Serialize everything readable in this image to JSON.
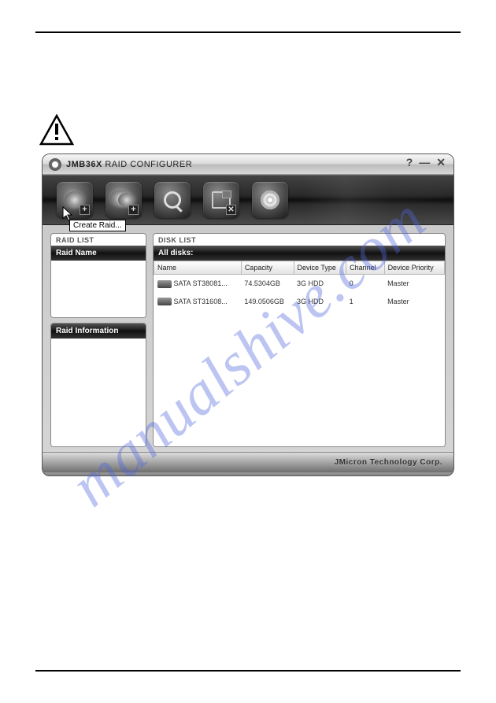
{
  "watermark": "manualshive.com",
  "window": {
    "title_bold": "JMB36X",
    "title_rest": " RAID CONFIGURER",
    "help": "?",
    "minimize": "—",
    "close": "✕"
  },
  "toolbar": {
    "tooltip": "Create Raid...",
    "buttons": [
      "create-raid",
      "create-raid-from",
      "rescan",
      "save",
      "disc"
    ]
  },
  "panels": {
    "raid_list_title": "Raid List",
    "raid_name_header": "Raid Name",
    "raid_info_header": "Raid Information",
    "disk_list_title": "Disk List",
    "all_disks_header": "All disks:"
  },
  "disk_table": {
    "columns": [
      "Name",
      "Capacity",
      "Device Type",
      "Channel",
      "Device Priority"
    ],
    "rows": [
      {
        "name": "SATA   ST38081...",
        "capacity": "74.5304GB",
        "device_type": "3G HDD",
        "channel": "0",
        "priority": "Master"
      },
      {
        "name": "SATA   ST31608...",
        "capacity": "149.0506GB",
        "device_type": "3G HDD",
        "channel": "1",
        "priority": "Master"
      }
    ]
  },
  "footer": "JMicron Technology Corp."
}
